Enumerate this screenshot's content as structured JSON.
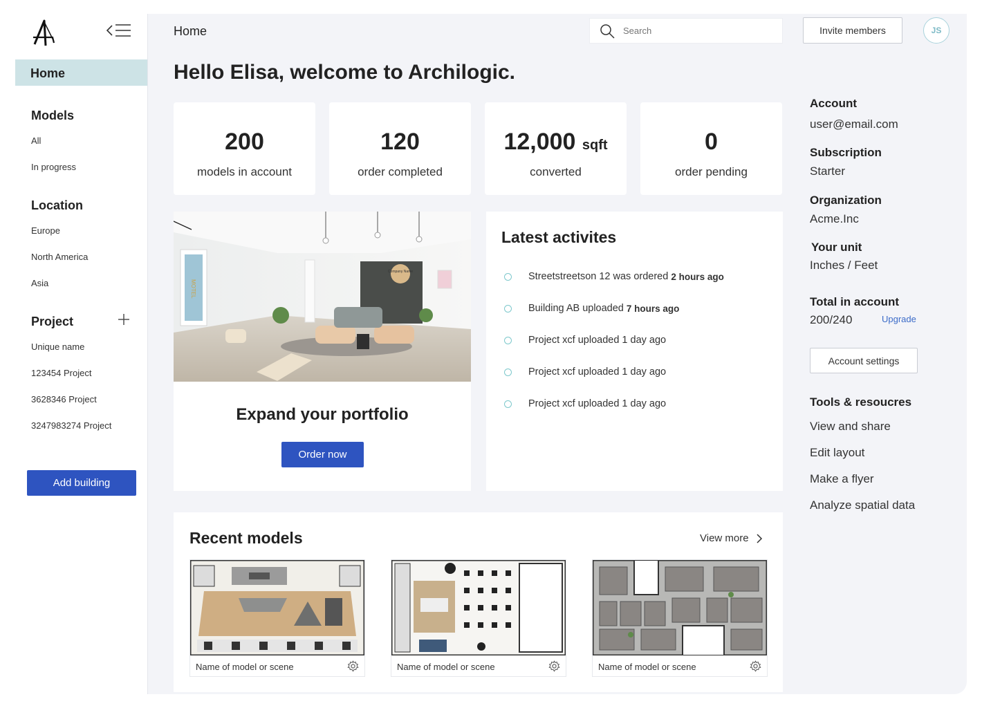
{
  "sidebar": {
    "home_label": "Home",
    "models": {
      "title": "Models",
      "items": [
        "All",
        "In progress"
      ]
    },
    "location": {
      "title": "Location",
      "items": [
        "Europe",
        "North America",
        "Asia"
      ]
    },
    "project": {
      "title": "Project",
      "items": [
        "Unique name",
        "123454 Project",
        "3628346 Project",
        "3247983274 Project"
      ]
    },
    "add_building_label": "Add building"
  },
  "header": {
    "breadcrumb": "Home",
    "search_placeholder": "Search",
    "invite_label": "Invite members",
    "avatar_initials": "JS"
  },
  "welcome": "Hello Elisa, welcome to Archilogic.",
  "stats": [
    {
      "value": "200",
      "unit": "",
      "label": "models in account"
    },
    {
      "value": "120",
      "unit": "",
      "label": "order completed"
    },
    {
      "value": "12,000",
      "unit": "sqft",
      "label": "converted"
    },
    {
      "value": "0",
      "unit": "",
      "label": "order pending"
    }
  ],
  "promo": {
    "image_sign": "Company Name",
    "poster_text": "MOTEL",
    "title": "Expand your portfolio",
    "button_label": "Order now"
  },
  "activities": {
    "title": "Latest activites",
    "items": [
      {
        "text": "Streetstreetson 12 was ordered",
        "time": "2 hours ago"
      },
      {
        "text": "Building AB uploaded",
        "time": "7 hours ago"
      },
      {
        "text": "Project xcf uploaded 1 day ago",
        "time": ""
      },
      {
        "text": "Project xcf uploaded 1 day ago",
        "time": ""
      },
      {
        "text": "Project xcf uploaded 1 day ago",
        "time": ""
      }
    ]
  },
  "recent": {
    "title": "Recent models",
    "view_more": "View more",
    "models": [
      {
        "name": "Name of model or scene"
      },
      {
        "name": "Name of model or scene"
      },
      {
        "name": "Name of model or scene"
      }
    ]
  },
  "account": {
    "account_label": "Account",
    "email": "user@email.com",
    "subscription_label": "Subscription",
    "subscription": "Starter",
    "organization_label": "Organization",
    "organization": "Acme.Inc",
    "unit_label": "Your unit",
    "unit": "Inches / Feet",
    "total_label": "Total in account",
    "total": "200/240",
    "upgrade_label": "Upgrade",
    "settings_label": "Account settings"
  },
  "tools": {
    "title": "Tools & resoucres",
    "items": [
      "View and share",
      "Edit layout",
      "Make a flyer",
      "Analyze spatial data"
    ]
  },
  "colors": {
    "primary": "#2e54c0",
    "home_highlight": "#cde3e6",
    "accent_teal": "#7dc8cc",
    "link": "#3b6bc8"
  }
}
